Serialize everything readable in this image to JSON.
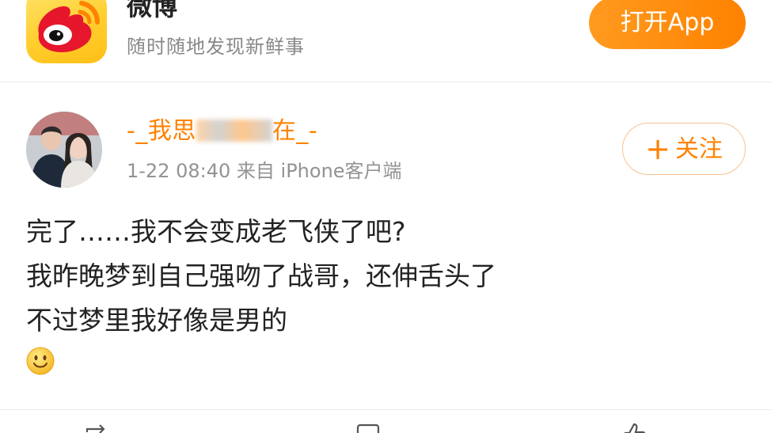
{
  "app": {
    "name": "微博",
    "slogan": "随时随地发现新鲜事",
    "open_button_label": "打开App",
    "brand_color": "#ff8200",
    "logo_icon": "weibo-logo-icon"
  },
  "post": {
    "username_prefix": "-_我思",
    "username_suffix": "在_-",
    "timestamp": "1-22 08:40",
    "source": "来自 iPhone客户端",
    "follow_label": "关注",
    "follow_icon": "plus-icon",
    "lines": [
      "完了……我不会变成老飞侠了吧?",
      "我昨晚梦到自己强吻了战哥，还伸舌头了",
      "不过梦里我好像是男的"
    ],
    "emoji_icon": "smile-emoji-icon"
  },
  "actions": {
    "repost_icon": "repost-icon",
    "comment_icon": "comment-icon",
    "like_icon": "like-icon"
  }
}
